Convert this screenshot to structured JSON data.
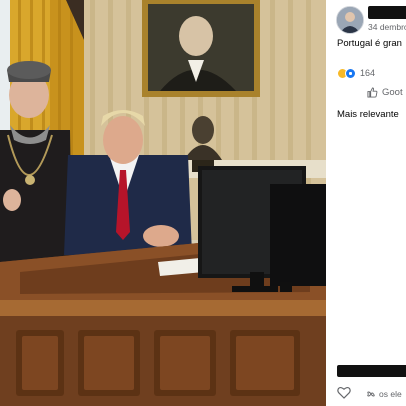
{
  "post": {
    "date": "34 dembro",
    "text": "Portugal é gran",
    "reaction_count": "164",
    "like_label": "Goot",
    "sort_label": "Mais relevante",
    "bottom_text": "os ele"
  },
  "icons": {
    "reactions": [
      "haha-emoji-icon",
      "like-emoji-icon"
    ],
    "like": "thumbs-up-icon",
    "heart": "heart-icon"
  },
  "colors": {
    "like_blue": "#1877f2",
    "haha_yellow": "#f7b928",
    "secondary_text": "#65676b"
  }
}
